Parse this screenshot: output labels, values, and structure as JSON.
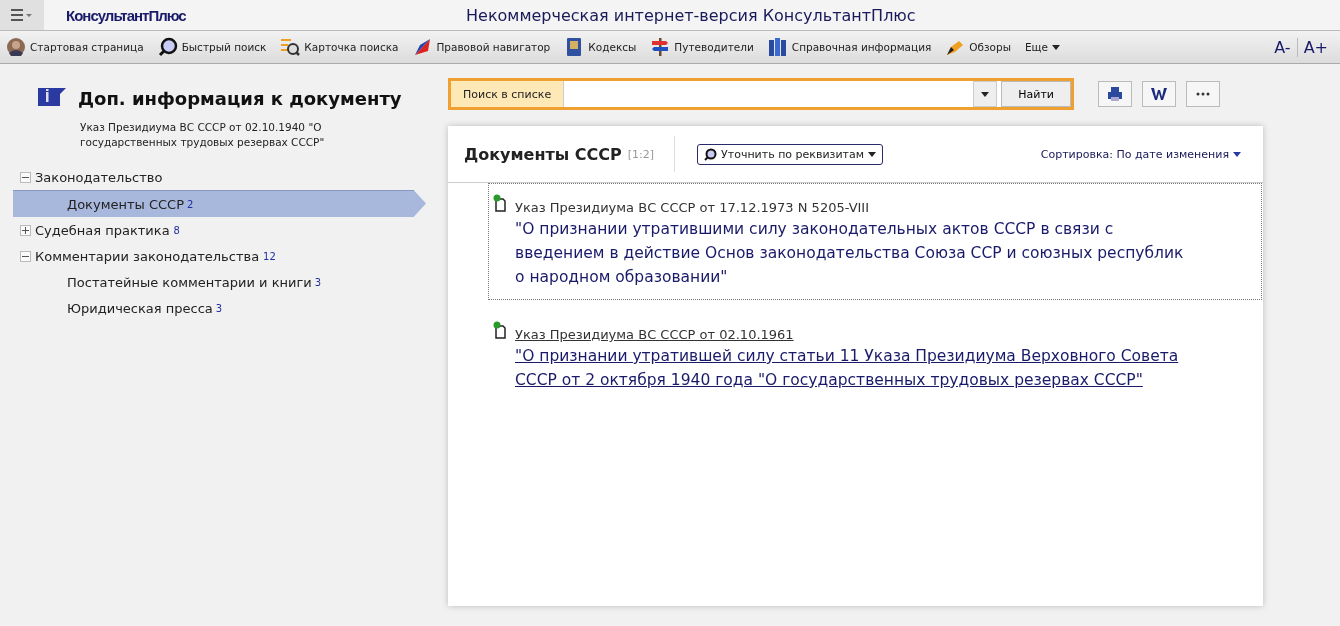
{
  "header": {
    "logo": "КонсультантПлюс",
    "title": "Некоммерческая интернет-версия КонсультантПлюс"
  },
  "toolbar": [
    {
      "kind": "avatar",
      "label": "Стартовая страница"
    },
    {
      "kind": "search",
      "label": "Быстрый поиск"
    },
    {
      "kind": "card",
      "label": "Карточка поиска"
    },
    {
      "kind": "flag",
      "label": "Правовой навигатор"
    },
    {
      "kind": "book",
      "label": "Кодексы"
    },
    {
      "kind": "signpost",
      "label": "Путеводители"
    },
    {
      "kind": "books",
      "label": "Справочная информация"
    },
    {
      "kind": "pen",
      "label": "Обзоры"
    },
    {
      "kind": "more",
      "label": "Еще"
    }
  ],
  "font_buttons": [
    "A-",
    "A+"
  ],
  "sidebar": {
    "title": "Доп. информация к документу",
    "subtitle": "Указ Президиума ВС СССР от 02.10.1940 \"О государственных трудовых резервах СССР\"",
    "tree": [
      {
        "label": "Законодательство",
        "expanded": true,
        "children": [
          {
            "label": "Документы СССР",
            "count": "2",
            "selected": true
          }
        ]
      },
      {
        "label": "Судебная практика",
        "count": "8",
        "expanded": false
      },
      {
        "label": "Комментарии законодательства",
        "count": "12",
        "expanded": true,
        "children": [
          {
            "label": "Постатейные комментарии и книги",
            "count": "3",
            "selected": false
          },
          {
            "label": "Юридическая пресса",
            "count": "3",
            "selected": false
          }
        ]
      }
    ]
  },
  "search": {
    "label": "Поиск в списке",
    "button": "Найти"
  },
  "list": {
    "title": "Документы СССР",
    "range": "[1:2]",
    "refine": "Уточнить по реквизитам",
    "sort": "Сортировка: По дате изменения",
    "documents": [
      {
        "source": "Указ Президиума ВС СССР от 17.12.1973 N 5205-VIII",
        "title": "\"О признании утратившими силу законодательных актов СССР в связи с введением в действие Основ законодательства Союза ССР и союзных республик о народном образовании\"",
        "selected": true,
        "hovered": false
      },
      {
        "source": "Указ Президиума ВС СССР от 02.10.1961",
        "title": "\"О признании утратившей силу статьи 11 Указа Президиума Верховного Совета СССР от 2 октября 1940 года \"О государственных трудовых резервах СССР\"",
        "selected": false,
        "hovered": true
      }
    ]
  }
}
